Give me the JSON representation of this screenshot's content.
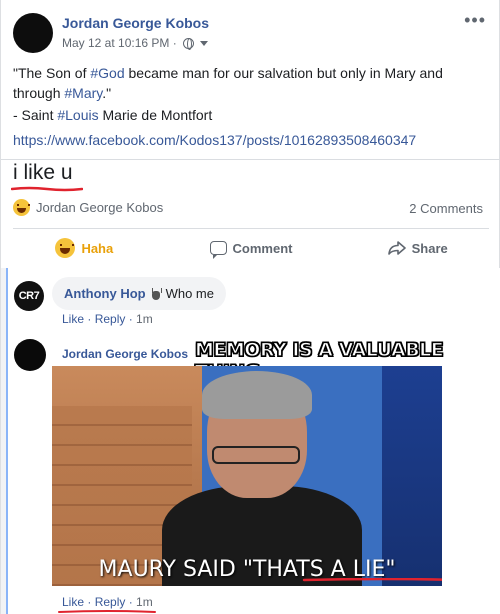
{
  "post": {
    "author": "Jordan George Kobos",
    "timestamp": "May 12 at 10:16 PM ·",
    "privacy_icon": "globe-icon",
    "more_label": "•••",
    "quote_a": "\"The Son of ",
    "hash_god": "#God",
    "quote_b": " became man for our salvation but only in Mary and through ",
    "hash_mary": "#Mary",
    "quote_c": ".\"",
    "attribution_a": "- Saint ",
    "hash_louis": "#Louis",
    "attribution_b": " Marie de Montfort",
    "link": "https://www.facebook.com/Kodos137/posts/10162893508460347"
  },
  "annotation": {
    "handwritten_text": "i like u",
    "scribble_color": "#e0232e"
  },
  "reactions": {
    "reactor": "Jordan George Kobos",
    "comments_count": "2 Comments"
  },
  "actions": {
    "haha": "Haha",
    "comment": "Comment",
    "share": "Share"
  },
  "comments": [
    {
      "avatar_text": "CR7",
      "name": "Anthony Hop",
      "text": "Who me",
      "like": "Like",
      "reply": "Reply",
      "time": "1m"
    },
    {
      "name": "Jordan George Kobos",
      "overlay_caption": "MEMORY IS A VALUABLE THING.",
      "gif_caption": "MAURY SAID \"THATS A LIE\"",
      "like": "Like",
      "reply": "Reply",
      "time": "1m"
    }
  ],
  "colors": {
    "link_blue": "#385898",
    "haha_yellow": "#e9a10a",
    "red_scribble": "#e0232e"
  }
}
